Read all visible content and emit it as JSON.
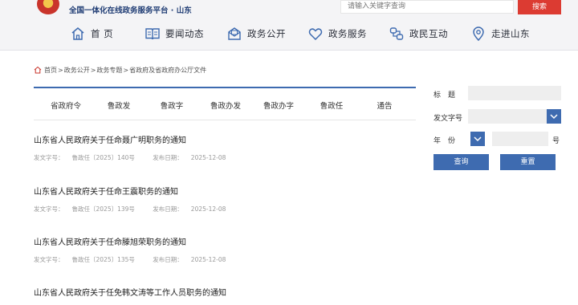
{
  "header": {
    "platform_text": "全国一体化在线政务服务平台 · 山东",
    "search_placeholder": "请输入关键字查询",
    "search_button": "搜索"
  },
  "nav": [
    {
      "label": "首 页",
      "icon": "home-icon"
    },
    {
      "label": "要闻动态",
      "icon": "book-icon"
    },
    {
      "label": "政务公开",
      "icon": "mail-open-icon"
    },
    {
      "label": "政务服务",
      "icon": "heart-icon"
    },
    {
      "label": "政民互动",
      "icon": "link-icon"
    },
    {
      "label": "走进山东",
      "icon": "location-pin-icon"
    }
  ],
  "breadcrumb": [
    "首页",
    "政务公开",
    "政务专题",
    "省政府及省政府办公厅文件"
  ],
  "breadcrumb_sep": ">",
  "tabs": [
    "省政府令",
    "鲁政发",
    "鲁政字",
    "鲁政办发",
    "鲁政办字",
    "鲁政任",
    "通告"
  ],
  "meta_labels": {
    "doc_no": "发文字号：",
    "date": "发布日期："
  },
  "documents": [
    {
      "title": "山东省人民政府关于任命聂广明职务的通知",
      "doc_no": "鲁政任〔2025〕140号",
      "date": "2025-12-08"
    },
    {
      "title": "山东省人民政府关于任命王震职务的通知",
      "doc_no": "鲁政任〔2025〕139号",
      "date": "2025-12-08"
    },
    {
      "title": "山东省人民政府关于任命滕旭荣职务的通知",
      "doc_no": "鲁政任〔2025〕135号",
      "date": "2025-12-08"
    },
    {
      "title": "山东省人民政府关于任免韩文涛等工作人员职务的通知"
    }
  ],
  "filter": {
    "title_label": "标　题",
    "doc_no_label": "发文字号",
    "year_label": "年　份",
    "number_suffix": "号",
    "query_button": "查询",
    "reset_button": "重置"
  },
  "colors": {
    "accent_blue": "#3e6bb0",
    "search_red": "#dc3b32",
    "nav_bg": "#f4f4f6"
  }
}
